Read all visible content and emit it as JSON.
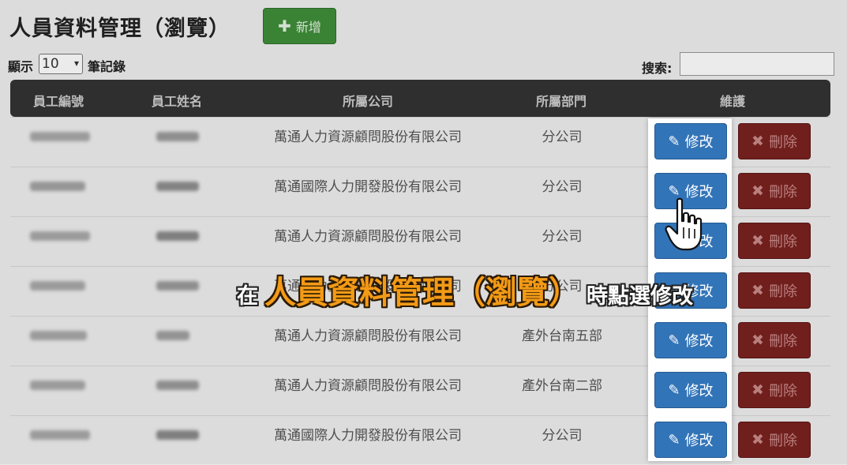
{
  "page": {
    "title": "人員資料管理（瀏覽）",
    "add_button": "新增",
    "length_label": "顯示",
    "length_value": "10",
    "length_suffix": "筆記錄",
    "search_label": "搜索:",
    "search_value": ""
  },
  "table": {
    "headers": [
      "員工編號",
      "員工姓名",
      "所屬公司",
      "所屬部門",
      "維護"
    ],
    "rows": [
      {
        "company": "萬通人力資源顧問股份有限公司",
        "dept": "分公司"
      },
      {
        "company": "萬通國際人力開發股份有限公司",
        "dept": "分公司"
      },
      {
        "company": "萬通人力資源顧問股份有限公司",
        "dept": "分公司"
      },
      {
        "company": "萬通人力資源顧問股份有限公司",
        "dept": "分公司"
      },
      {
        "company": "萬通人力資源顧問股份有限公司",
        "dept": "產外台南五部"
      },
      {
        "company": "萬通人力資源顧問股份有限公司",
        "dept": "產外台南二部"
      },
      {
        "company": "萬通國際人力開發股份有限公司",
        "dept": "分公司"
      }
    ],
    "edit_label": "修改",
    "delete_label": "刪除"
  },
  "caption": {
    "prefix": "在",
    "highlight": "人員資料管理（瀏覽）",
    "suffix": "時點選修改"
  },
  "colors": {
    "edit": "#3274b8",
    "delete": "#7a2220",
    "add": "#3f8f3a",
    "caption_highlight": "#f39a16"
  }
}
